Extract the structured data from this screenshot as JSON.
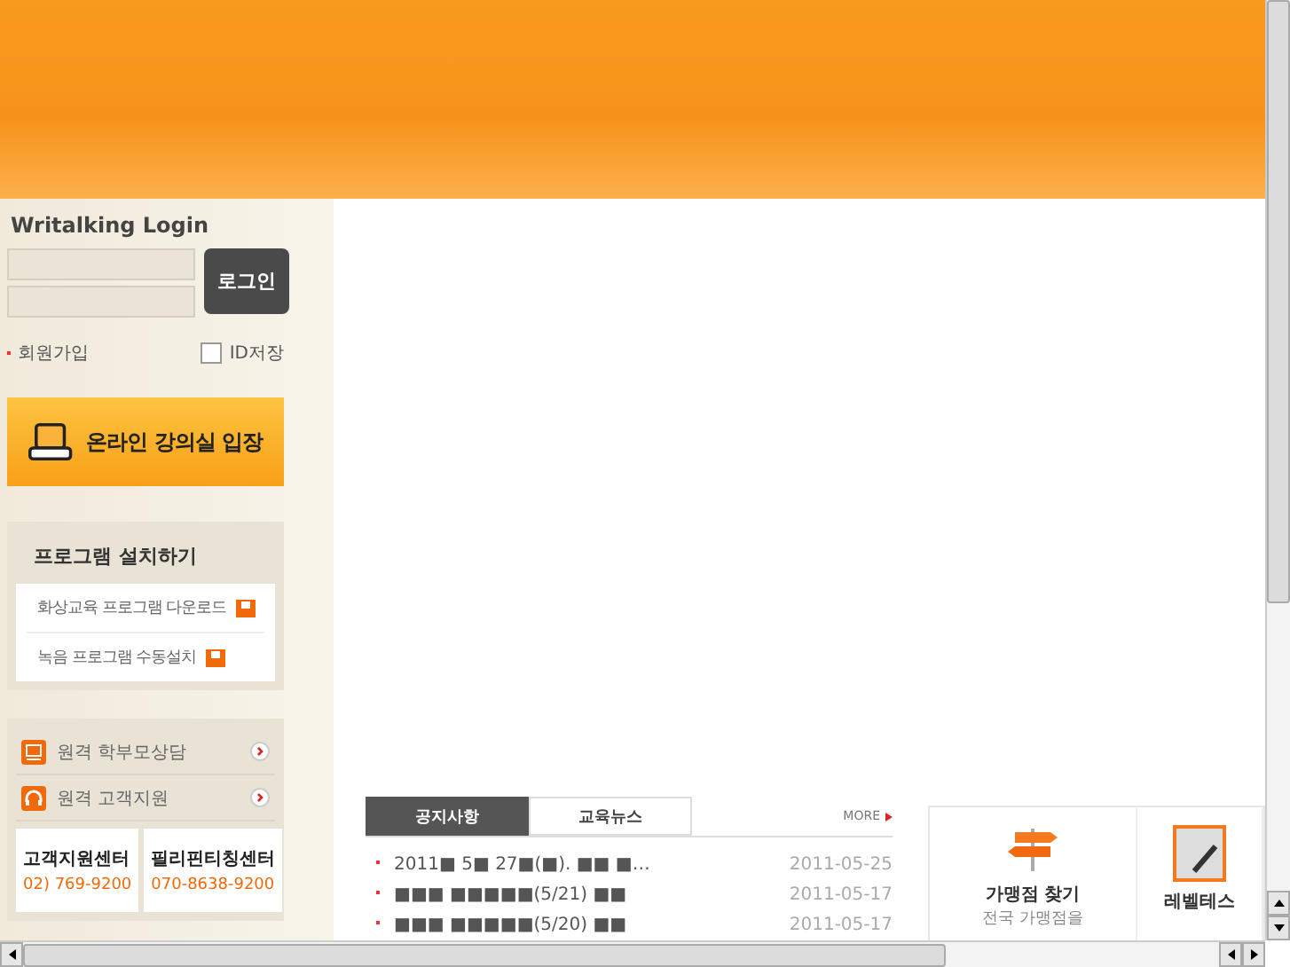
{
  "login": {
    "title": "Writalking Login",
    "button": "로그인",
    "signup": "회원가입",
    "remember": {
      "label": "ID저장",
      "checked": false
    }
  },
  "classroom_button": "온라인 강의실 입장",
  "install": {
    "title": "프로그램 설치하기",
    "items": [
      "화상교육 프로그램 다운로드",
      "녹음 프로그램 수동설치"
    ]
  },
  "remote": [
    {
      "label": "원격 학부모상담",
      "kind": "monitor"
    },
    {
      "label": "원격 고객지원",
      "kind": "headset"
    }
  ],
  "contacts": [
    {
      "name": "고객지원센터",
      "phone": "02) 769-9200"
    },
    {
      "name": "필리핀티칭센터",
      "phone": "070-8638-9200"
    }
  ],
  "board": {
    "tabs": [
      {
        "label": "공지사항",
        "selected": true
      },
      {
        "label": "교육뉴스",
        "selected": false
      }
    ],
    "more": "MORE",
    "rows": [
      {
        "title": "2011■ 5■ 27■(■). ■■ ■…",
        "date": "2011-05-25"
      },
      {
        "title": "■■■ ■■■■■(5/21) ■■",
        "date": "2011-05-17"
      },
      {
        "title": "■■■ ■■■■■(5/20) ■■",
        "date": "2011-05-17"
      }
    ]
  },
  "services": [
    {
      "title": "가맹점 찾기",
      "desc": "전국 가맹점을",
      "kind": "signpost"
    },
    {
      "title": "레벨테스",
      "kind": "clipboard"
    }
  ]
}
